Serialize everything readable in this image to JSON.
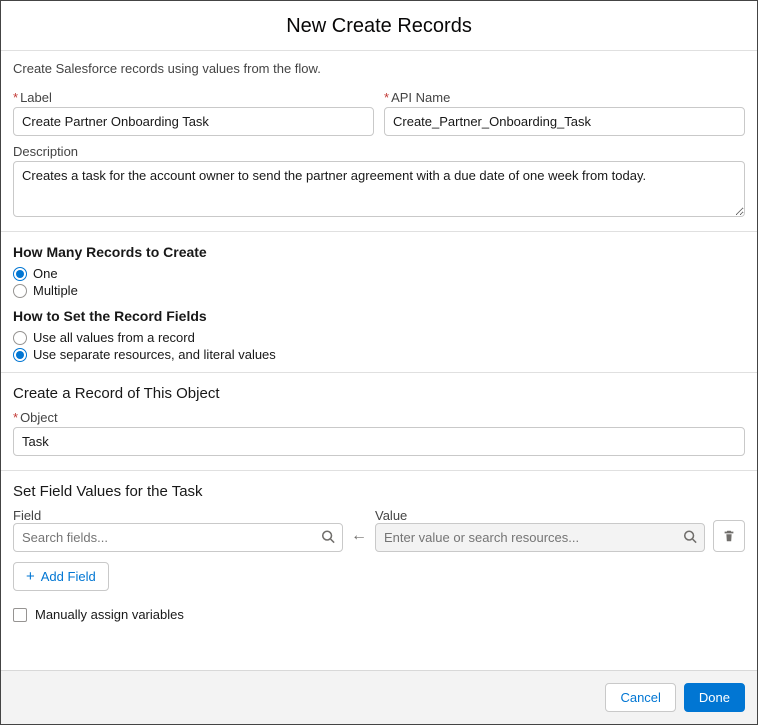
{
  "header": {
    "title": "New Create Records"
  },
  "intro": "Create Salesforce records using values from the flow.",
  "labelField": {
    "label": "Label",
    "value": "Create Partner Onboarding Task"
  },
  "apiNameField": {
    "label": "API Name",
    "value": "Create_Partner_Onboarding_Task"
  },
  "descriptionField": {
    "label": "Description",
    "value": "Creates a task for the account owner to send the partner agreement with a due date of one week from today."
  },
  "howMany": {
    "heading": "How Many Records to Create",
    "options": {
      "one": "One",
      "multiple": "Multiple"
    },
    "selected": "one"
  },
  "howSet": {
    "heading": "How to Set the Record Fields",
    "options": {
      "allValues": "Use all values from a record",
      "separate": "Use separate resources, and literal values"
    },
    "selected": "separate"
  },
  "objectSection": {
    "heading": "Create a Record of This Object",
    "label": "Object",
    "value": "Task"
  },
  "fieldValues": {
    "heading": "Set Field Values for the Task",
    "fieldLabel": "Field",
    "valueLabel": "Value",
    "fieldPlaceholder": "Search fields...",
    "valuePlaceholder": "Enter value or search resources...",
    "addField": "Add Field"
  },
  "manualAssign": {
    "label": "Manually assign variables"
  },
  "footer": {
    "cancel": "Cancel",
    "done": "Done"
  }
}
